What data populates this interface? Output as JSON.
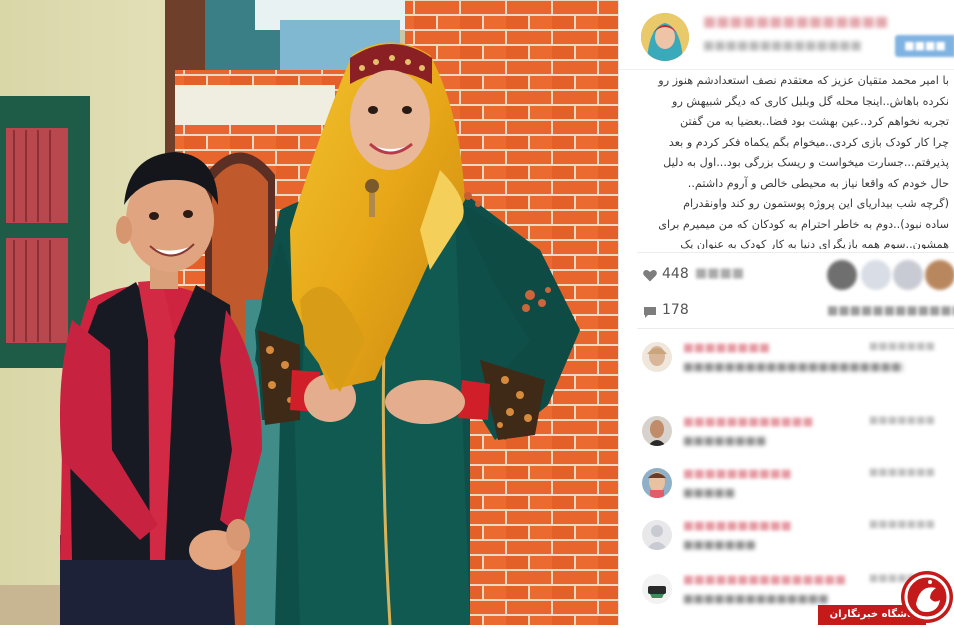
{
  "post": {
    "caption_lines": [
      "با امیر محمد متقیان عزیز که معتقدم نصف استعدادشم هنوز رو",
      "نکرده باهاش..اینجا محله گل وبلبل کاری که دیگر شبیهش رو",
      "تجربه نخواهم کرد..عین بهشت بود فضا..بعضیا به من گفتن",
      "چرا کار کودک بازی کردی..میخوام بگم یکماه فکر کردم و بعد",
      "پذیرفتم...جسارت میخواست و ریسک بزرگی بود...اول به دلیل",
      "حال خودم که واقعا نیاز به محیطی خالص و آروم داشتم..",
      "(گرچه شب بیداریای این پروژه پوستمون رو کند واونقدرام",
      "ساده نبود)..دوم به خاطر احترام به کودکان که من میمیرم برای",
      "همشون..سوم همه بازیگرای دنیا به کار کودک به عنوان یک"
    ],
    "likes_count": "448",
    "comments_count": "178"
  },
  "watermark": {
    "text": "باشگاه خبرنگاران",
    "brand_color": "#c41a1a"
  },
  "icons": {
    "likes": "heart-icon",
    "comments": "comment-icon"
  }
}
